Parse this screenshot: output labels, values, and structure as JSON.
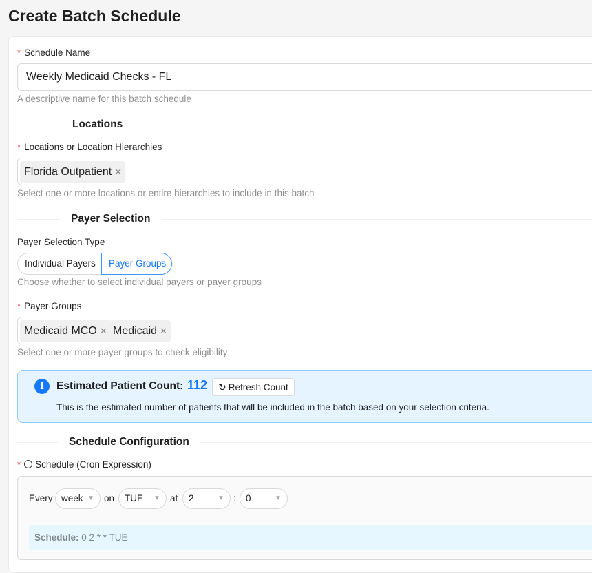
{
  "page": {
    "title": "Create Batch Schedule"
  },
  "schedule_name": {
    "label": "Schedule Name",
    "value": "Weekly Medicaid Checks - FL",
    "help": "A descriptive name for this batch schedule"
  },
  "locations_section": {
    "title": "Locations",
    "field_label": "Locations or Location Hierarchies",
    "tags": [
      "Florida Outpatient"
    ],
    "help": "Select one or more locations or entire hierarchies to include in this batch"
  },
  "payer_section": {
    "title": "Payer Selection",
    "type_label": "Payer Selection Type",
    "options": [
      "Individual Payers",
      "Payer Groups"
    ],
    "selected": "Payer Groups",
    "type_help": "Choose whether to select individual payers or payer groups",
    "groups_label": "Payer Groups",
    "group_tags": [
      "Medicaid MCO",
      "Medicaid"
    ],
    "groups_help": "Select one or more payer groups to check eligibility"
  },
  "estimate": {
    "title": "Estimated Patient Count:",
    "count": "112",
    "refresh_label": "Refresh Count",
    "description": "This is the estimated number of patients that will be included in the batch based on your selection criteria."
  },
  "schedule_section": {
    "title": "Schedule Configuration",
    "cron_label": "Schedule (Cron Expression)",
    "every_label": "Every",
    "period": "week",
    "on_label": "on",
    "day": "TUE",
    "at_label": "at",
    "hour": "2",
    "colon": ":",
    "minute": "0",
    "preview_label": "Schedule:",
    "preview_value": "0 2 * * TUE"
  },
  "colors": {
    "primary": "#1677ff",
    "required": "#ff4d4f",
    "alert_bg": "#e6f4ff",
    "count_color": "#1677ff"
  }
}
